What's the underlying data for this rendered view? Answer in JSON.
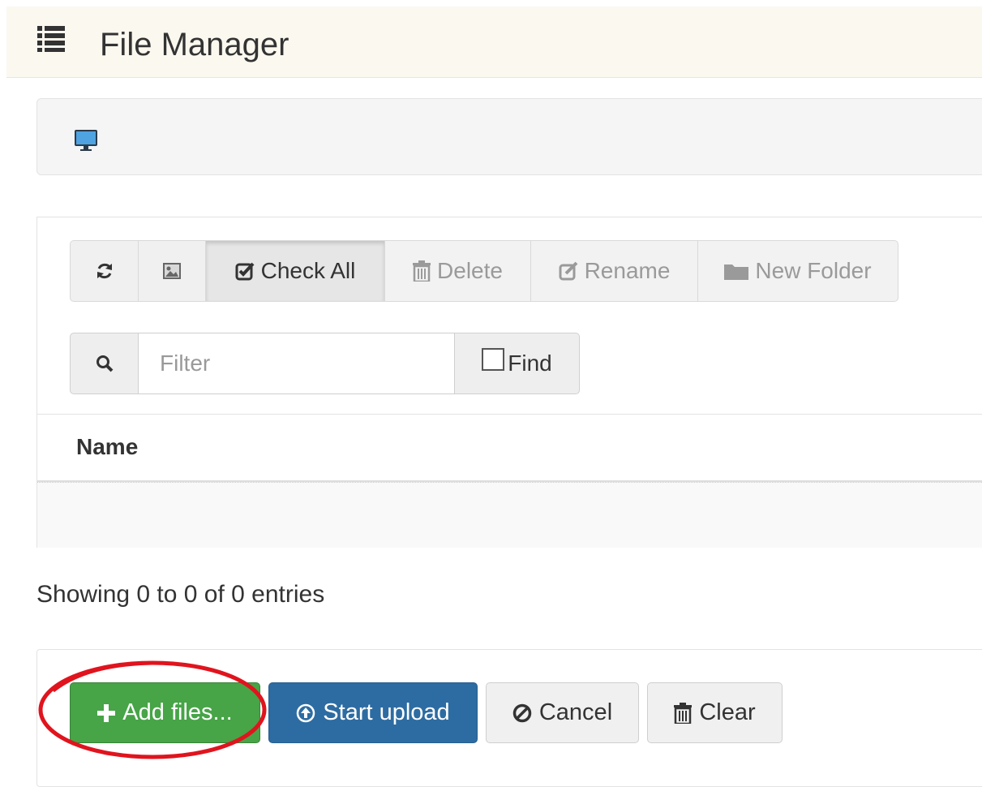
{
  "header": {
    "title": "File Manager",
    "icon": "list-icon"
  },
  "breadcrumb": {
    "icon": "computer-monitor-icon"
  },
  "toolbar": {
    "refresh_icon": "refresh-icon",
    "image_icon": "image-icon",
    "check_all_label": "Check All",
    "delete_label": "Delete",
    "rename_label": "Rename",
    "new_folder_label": "New Folder"
  },
  "filter": {
    "placeholder": "Filter",
    "value": "",
    "find_label": "Find",
    "find_checked": false
  },
  "table": {
    "columns": [
      "Name"
    ],
    "rows": []
  },
  "entries_info": "Showing 0 to 0 of 0 entries",
  "upload": {
    "add_files_label": "Add files...",
    "start_upload_label": "Start upload",
    "cancel_label": "Cancel",
    "clear_label": "Clear"
  },
  "colors": {
    "header_bg": "#fbf8ef",
    "success": "#47a447",
    "primary": "#2d6ca2",
    "annotation": "#e0141e"
  }
}
